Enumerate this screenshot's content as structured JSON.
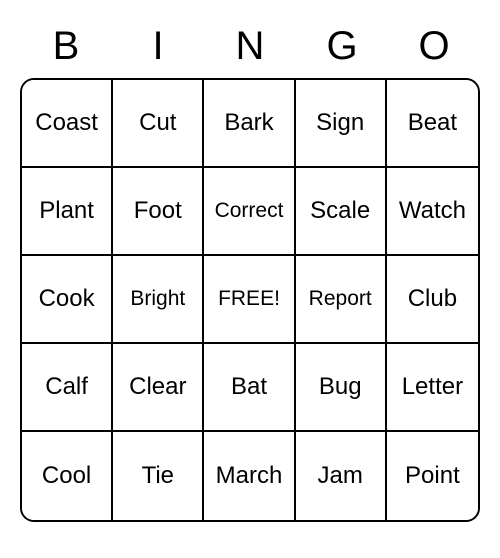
{
  "header": [
    "B",
    "I",
    "N",
    "G",
    "O"
  ],
  "grid": [
    [
      "Coast",
      "Cut",
      "Bark",
      "Sign",
      "Beat"
    ],
    [
      "Plant",
      "Foot",
      "Correct",
      "Scale",
      "Watch"
    ],
    [
      "Cook",
      "Bright",
      "FREE!",
      "Report",
      "Club"
    ],
    [
      "Calf",
      "Clear",
      "Bat",
      "Bug",
      "Letter"
    ],
    [
      "Cool",
      "Tie",
      "March",
      "Jam",
      "Point"
    ]
  ],
  "free_cell": {
    "row": 2,
    "col": 2
  }
}
